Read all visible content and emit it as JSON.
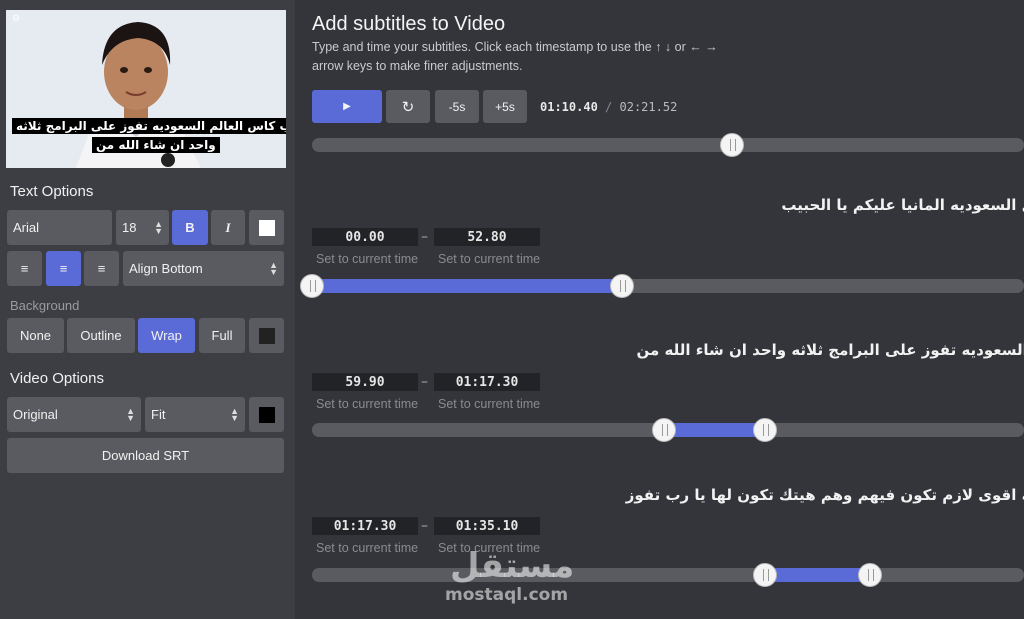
{
  "video": {
    "subtitle_line1": "ملعب كاس العالم السعوديه تفوز على البرامج ثلاثه",
    "subtitle_line2": "واحد ان شاء الله من"
  },
  "text_options": {
    "title": "Text Options",
    "font": "Arial",
    "size": "18",
    "bold": "B",
    "italic": "I",
    "align_select": "Align Bottom",
    "text_color": "#ffffff"
  },
  "background": {
    "title": "Background",
    "options": [
      "None",
      "Outline",
      "Wrap",
      "Full"
    ],
    "selected": "Wrap",
    "color": "#222222"
  },
  "video_options": {
    "title": "Video Options",
    "size_select": "Original",
    "fit_select": "Fit",
    "color": "#000000",
    "download": "Download SRT"
  },
  "main": {
    "title": "Add subtitles to Video",
    "description_line1": "Type and time your subtitles. Click each timestamp to use the ↑ ↓ or ← →",
    "description_line2": "arrow keys to make finer adjustments.",
    "back5": "-5s",
    "fwd5": "+5s",
    "current_time": "01:10.40",
    "separator": "/",
    "total_time": "02:21.52",
    "playhead_fraction": 0.498
  },
  "subtitles": [
    {
      "text": "ول السعوديه المانيا عليكم يا الحبيب",
      "start": "00.00",
      "end": "52.80",
      "set_start": "Set to current time",
      "set_end": "Set to current time"
    },
    {
      "text": "م السعوديه تفوز على البرامج ثلاثه واحد ان شاء الله من",
      "start": "59.90",
      "end": "01:17.30",
      "set_start": "Set to current time",
      "set_end": "Set to current time"
    },
    {
      "text": "ديه اقوى لازم تكون فيهم وهم هيتك تكون لها يا رب تفوز",
      "start": "01:17.30",
      "end": "01:35.10",
      "set_start": "Set to current time",
      "set_end": "Set to current time"
    }
  ],
  "watermark": {
    "arabic": "مستقل",
    "latin": "mostaql.com"
  },
  "colors": {
    "accent": "#5a6bd8",
    "panel": "#3d3e44",
    "main": "#34353a"
  }
}
